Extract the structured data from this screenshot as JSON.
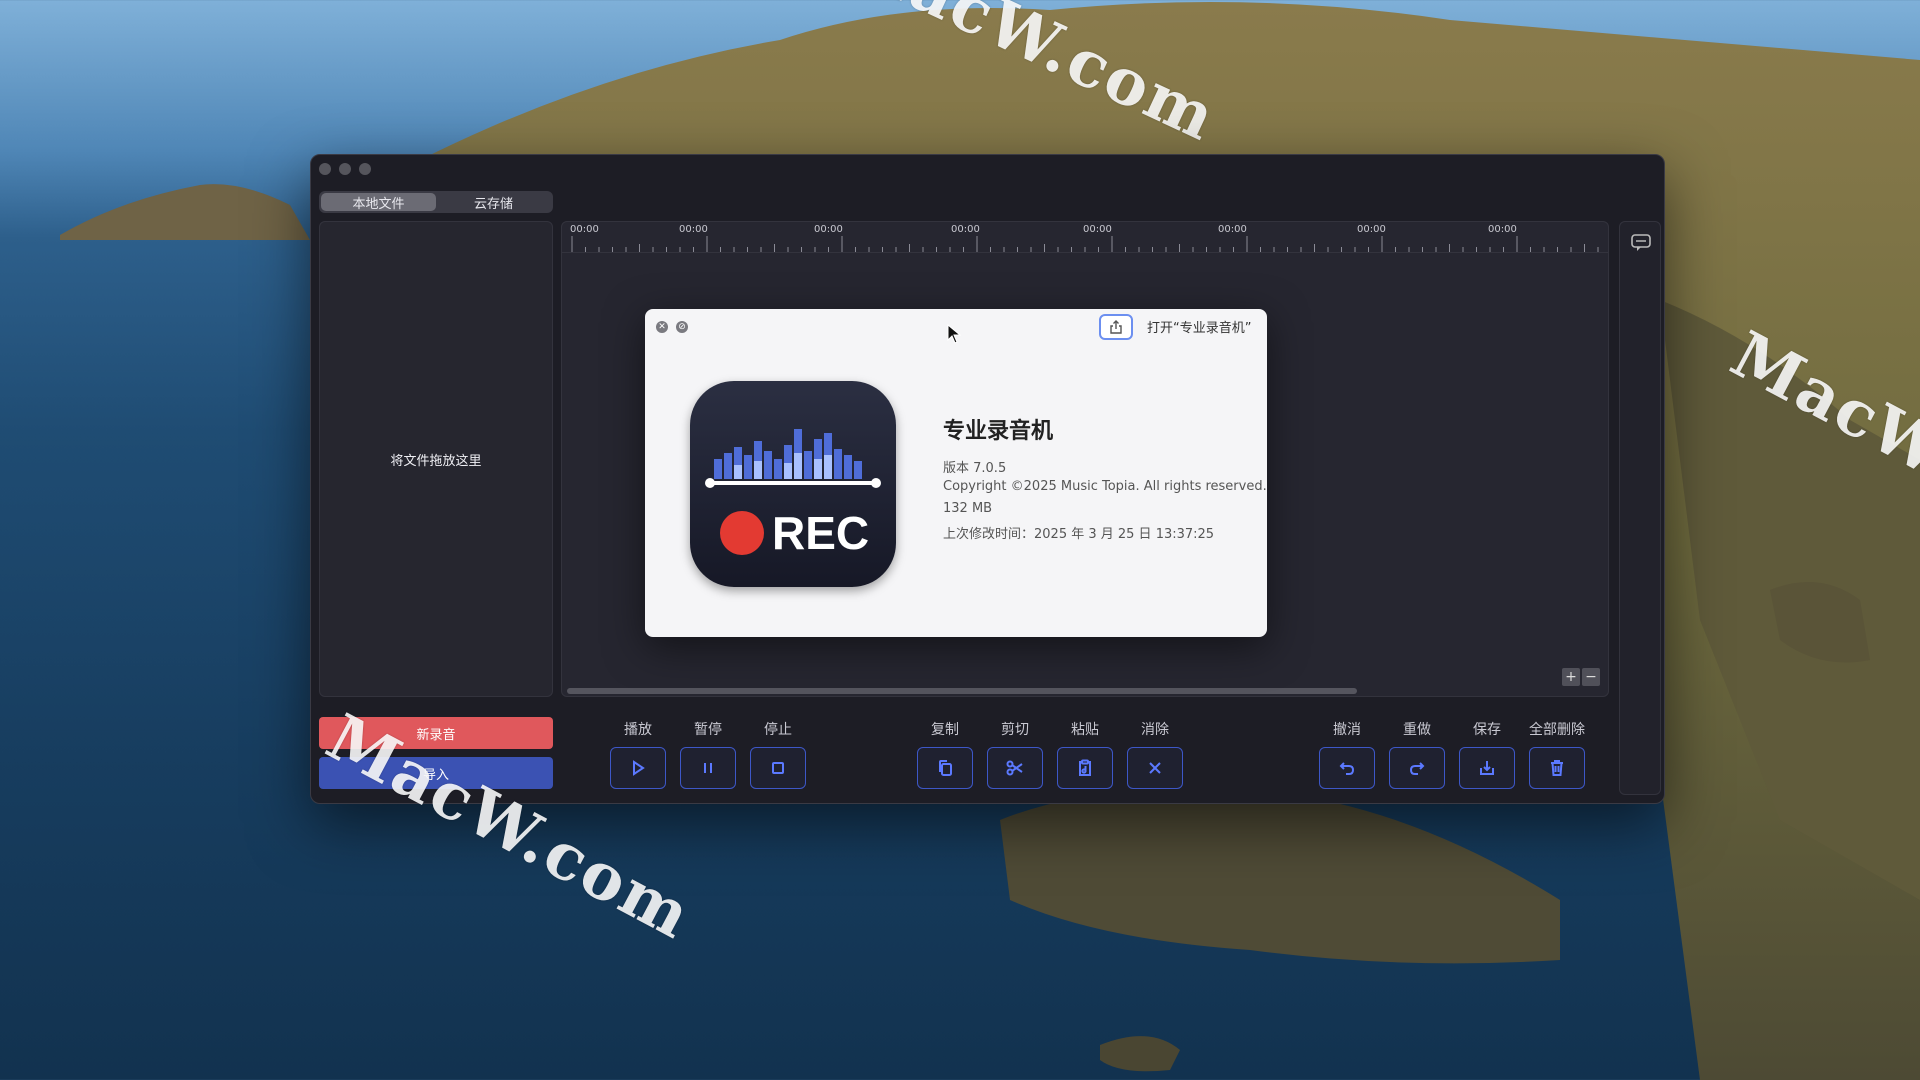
{
  "window": {
    "tabs": [
      "本地文件",
      "云存储"
    ],
    "drop_hint": "将文件拖放这里",
    "new_recording": "新录音",
    "import": "导入",
    "ruler_labels": [
      "00:00",
      "00:00",
      "00:00",
      "00:00",
      "00:00",
      "00:00",
      "00:00",
      "00:00"
    ],
    "zoom_in": "+",
    "zoom_out": "−",
    "tools": {
      "play": "播放",
      "pause": "暂停",
      "stop": "停止",
      "copy": "复制",
      "cut": "剪切",
      "paste": "粘贴",
      "clear": "消除",
      "undo": "撤消",
      "redo": "重做",
      "save": "保存",
      "delete_all": "全部删除"
    }
  },
  "about": {
    "open_label": "打开“专业录音机”",
    "app_name": "专业录音机",
    "version": "版本 7.0.5",
    "copyright": "Copyright ©2025 Music Topia. All rights reserved.",
    "size": "132 MB",
    "modified": "上次修改时间：2025 年 3 月 25 日 13:37:25",
    "icon_text": "REC"
  },
  "watermarks": [
    "MacW.com",
    "MacW.com",
    "MacW.c"
  ],
  "colors": {
    "record": "#e0585c",
    "import": "#3b52b3",
    "accent": "#5b79ff"
  }
}
